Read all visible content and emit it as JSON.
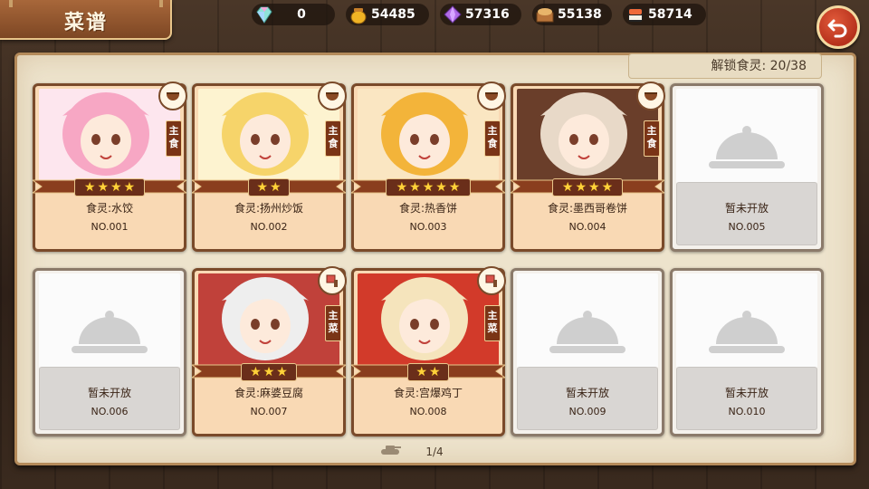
{
  "header": {
    "title": "菜谱"
  },
  "resources": [
    {
      "icon": "rainbow-gem-icon",
      "value": "0"
    },
    {
      "icon": "honey-pot-icon",
      "value": "54485"
    },
    {
      "icon": "purple-crystal-icon",
      "value": "57316"
    },
    {
      "icon": "bread-crate-icon",
      "value": "55138"
    },
    {
      "icon": "sushi-roll-icon",
      "value": "58714"
    }
  ],
  "unlock": {
    "text": "解锁食灵: 20/38"
  },
  "cards": [
    {
      "name": "食灵:水饺",
      "num": "NO.001",
      "stars": "★★★★",
      "type": "主食",
      "locked": false,
      "palette": [
        "#f7a7c4",
        "#fde6ee"
      ]
    },
    {
      "name": "食灵:扬州炒饭",
      "num": "NO.002",
      "stars": "★★",
      "type": "主食",
      "locked": false,
      "palette": [
        "#f6d46a",
        "#fdf3d0"
      ]
    },
    {
      "name": "食灵:热香饼",
      "num": "NO.003",
      "stars": "★★★★★",
      "type": "主食",
      "locked": false,
      "palette": [
        "#f3b43a",
        "#fae6c2"
      ]
    },
    {
      "name": "食灵:墨西哥卷饼",
      "num": "NO.004",
      "stars": "★★★★",
      "type": "主食",
      "locked": false,
      "palette": [
        "#e8d9c8",
        "#6a3e2a"
      ]
    },
    {
      "name": "暂未开放",
      "num": "NO.005",
      "locked": true
    },
    {
      "name": "暂未开放",
      "num": "NO.006",
      "locked": true
    },
    {
      "name": "食灵:麻婆豆腐",
      "num": "NO.007",
      "stars": "★★★",
      "type": "主菜",
      "locked": false,
      "palette": [
        "#eeeeee",
        "#c0413a"
      ]
    },
    {
      "name": "食灵:宫爆鸡丁",
      "num": "NO.008",
      "stars": "★★",
      "type": "主菜",
      "locked": false,
      "palette": [
        "#f5e4bc",
        "#d23a2a"
      ]
    },
    {
      "name": "暂未开放",
      "num": "NO.009",
      "locked": true
    },
    {
      "name": "暂未开放",
      "num": "NO.010",
      "locked": true
    }
  ],
  "pager": {
    "text": "1/4"
  },
  "colors": {
    "card_border": "#7a4a2a",
    "tag_bg": "#7a3416",
    "star": "#ffd23a",
    "back_button": "#c93b22"
  }
}
